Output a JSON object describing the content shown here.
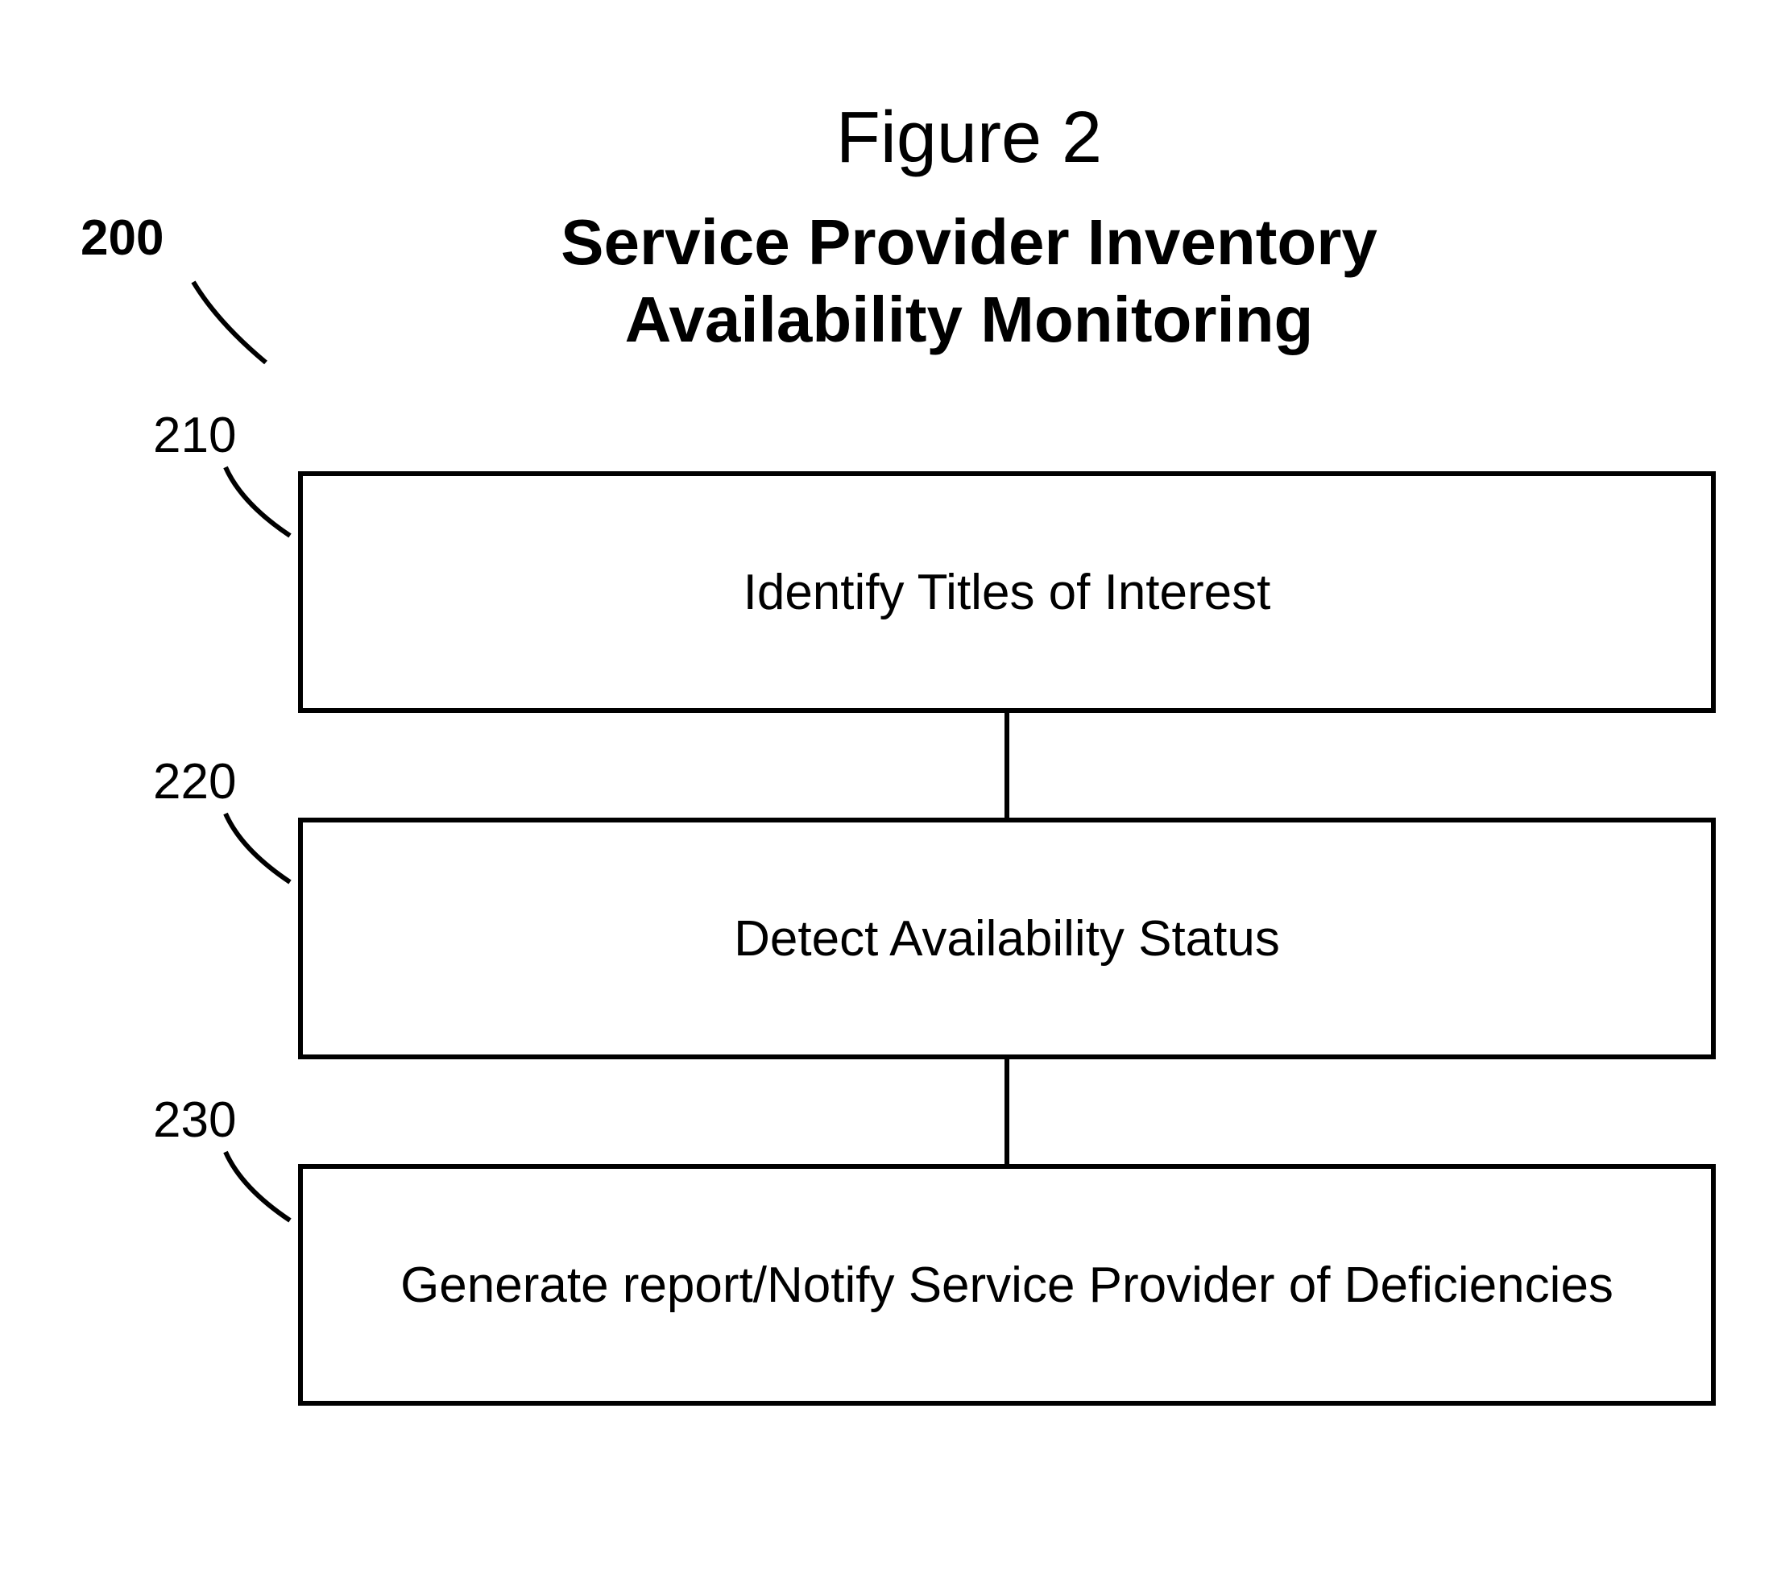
{
  "figure_label": "Figure 2",
  "subtitle_line1": "Service Provider Inventory",
  "subtitle_line2": "Availability  Monitoring",
  "ref_main": "200",
  "steps": [
    {
      "ref": "210",
      "text": "Identify Titles of Interest"
    },
    {
      "ref": "220",
      "text": "Detect Availability Status"
    },
    {
      "ref": "230",
      "text": "Generate report/Notify Service Provider of Deficiencies"
    }
  ]
}
